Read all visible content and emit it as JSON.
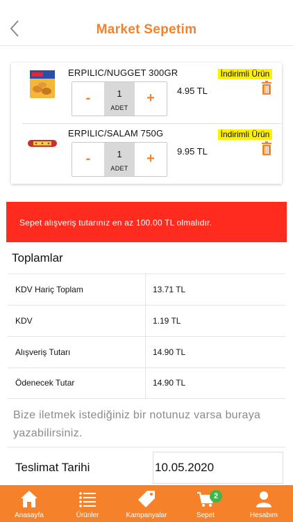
{
  "header": {
    "title": "Market Sepetim"
  },
  "cart_items": [
    {
      "name": "ERPILIC/NUGGET 300GR",
      "quantity": "1",
      "unit": "ADET",
      "price": "4.95 TL",
      "badge": "İndirimli Ürün",
      "minus": "-",
      "plus": "+"
    },
    {
      "name": "ERPILIC/SALAM 750G",
      "quantity": "1",
      "unit": "ADET",
      "price": "9.95 TL",
      "badge": "İndirimli Ürün",
      "minus": "-",
      "plus": "+"
    }
  ],
  "alert": {
    "text": "Sepet alışveriş tutarınız en az 100.00 TL olmalıdır.",
    "color": "#ff2b1f"
  },
  "totals": {
    "title": "Toplamlar",
    "rows": [
      {
        "label": "KDV Hariç Toplam",
        "value": "13.71 TL"
      },
      {
        "label": "KDV",
        "value": "1.19 TL"
      },
      {
        "label": "Alışveriş Tutarı",
        "value": "14.90 TL"
      },
      {
        "label": "Ödenecek Tutar",
        "value": "14.90 TL"
      }
    ]
  },
  "note": {
    "placeholder": "Bize iletmek istediğiniz bir notunuz varsa buraya yazabilirsiniz."
  },
  "delivery": {
    "label": "Teslimat Tarihi",
    "value": "10.05.2020"
  },
  "tabbar": {
    "items": [
      {
        "label": "Anasayfa",
        "icon": "home-icon"
      },
      {
        "label": "Ürünler",
        "icon": "list-icon"
      },
      {
        "label": "Kampanyalar",
        "icon": "tag-icon"
      },
      {
        "label": "Sepet",
        "icon": "cart-icon"
      },
      {
        "label": "Hesabım",
        "icon": "user-icon"
      }
    ],
    "cart_count": "2"
  },
  "colors": {
    "accent": "#f5822a",
    "badge": "#ffef00",
    "cart_badge": "#3fb54a"
  }
}
